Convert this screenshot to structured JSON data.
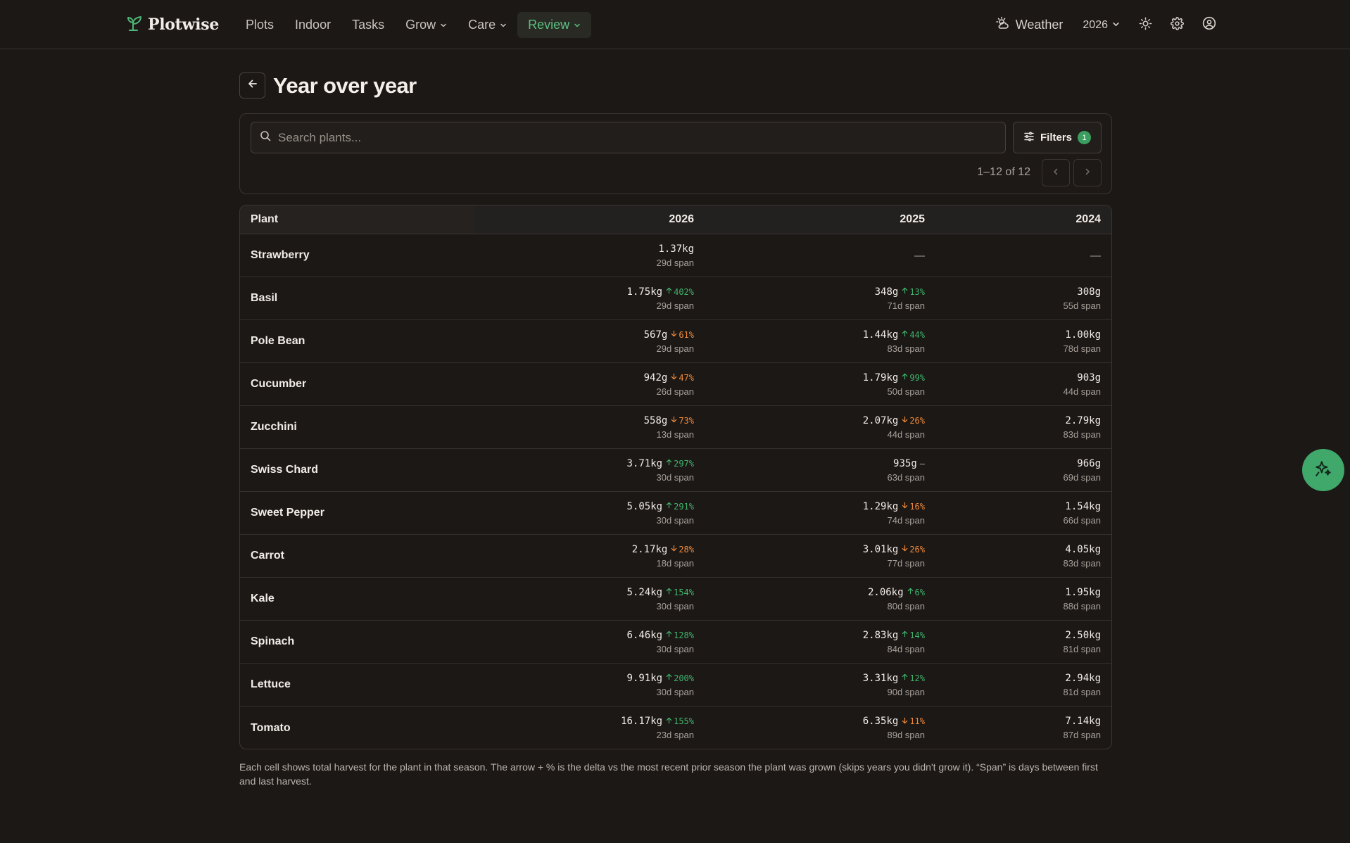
{
  "nav": {
    "brand": "Plotwise",
    "links": [
      {
        "label": "Plots",
        "dropdown": false,
        "active": false
      },
      {
        "label": "Indoor",
        "dropdown": false,
        "active": false
      },
      {
        "label": "Tasks",
        "dropdown": false,
        "active": false
      },
      {
        "label": "Grow",
        "dropdown": true,
        "active": false
      },
      {
        "label": "Care",
        "dropdown": true,
        "active": false
      },
      {
        "label": "Review",
        "dropdown": true,
        "active": true
      }
    ],
    "weather_label": "Weather",
    "year": "2026",
    "icons": [
      "sun-icon",
      "gear-icon",
      "user-circle-icon"
    ]
  },
  "page": {
    "title": "Year over year"
  },
  "toolbar": {
    "search_placeholder": "Search plants...",
    "filters_label": "Filters",
    "filters_count": "1",
    "pager_text": "1–12 of 12"
  },
  "table": {
    "headers": [
      "Plant",
      "2026",
      "2025",
      "2024"
    ],
    "rows": [
      {
        "plant": "Strawberry",
        "cells": [
          {
            "value": "1.37kg",
            "delta": "",
            "dir": "",
            "span": "29d span"
          },
          {
            "value": "—",
            "delta": "",
            "dir": "",
            "span": ""
          },
          {
            "value": "—",
            "delta": "",
            "dir": "",
            "span": ""
          }
        ]
      },
      {
        "plant": "Basil",
        "cells": [
          {
            "value": "1.75kg",
            "delta": "402%",
            "dir": "up",
            "span": "29d span"
          },
          {
            "value": "348g",
            "delta": "13%",
            "dir": "up",
            "span": "71d span"
          },
          {
            "value": "308g",
            "delta": "",
            "dir": "",
            "span": "55d span"
          }
        ]
      },
      {
        "plant": "Pole Bean",
        "cells": [
          {
            "value": "567g",
            "delta": "61%",
            "dir": "down",
            "span": "29d span"
          },
          {
            "value": "1.44kg",
            "delta": "44%",
            "dir": "up",
            "span": "83d span"
          },
          {
            "value": "1.00kg",
            "delta": "",
            "dir": "",
            "span": "78d span"
          }
        ]
      },
      {
        "plant": "Cucumber",
        "cells": [
          {
            "value": "942g",
            "delta": "47%",
            "dir": "down",
            "span": "26d span"
          },
          {
            "value": "1.79kg",
            "delta": "99%",
            "dir": "up",
            "span": "50d span"
          },
          {
            "value": "903g",
            "delta": "",
            "dir": "",
            "span": "44d span"
          }
        ]
      },
      {
        "plant": "Zucchini",
        "cells": [
          {
            "value": "558g",
            "delta": "73%",
            "dir": "down",
            "span": "13d span"
          },
          {
            "value": "2.07kg",
            "delta": "26%",
            "dir": "down",
            "span": "44d span"
          },
          {
            "value": "2.79kg",
            "delta": "",
            "dir": "",
            "span": "83d span"
          }
        ]
      },
      {
        "plant": "Swiss Chard",
        "cells": [
          {
            "value": "3.71kg",
            "delta": "297%",
            "dir": "up",
            "span": "30d span"
          },
          {
            "value": "935g",
            "delta": "—",
            "dir": "flat",
            "span": "63d span"
          },
          {
            "value": "966g",
            "delta": "",
            "dir": "",
            "span": "69d span"
          }
        ]
      },
      {
        "plant": "Sweet Pepper",
        "cells": [
          {
            "value": "5.05kg",
            "delta": "291%",
            "dir": "up",
            "span": "30d span"
          },
          {
            "value": "1.29kg",
            "delta": "16%",
            "dir": "down",
            "span": "74d span"
          },
          {
            "value": "1.54kg",
            "delta": "",
            "dir": "",
            "span": "66d span"
          }
        ]
      },
      {
        "plant": "Carrot",
        "cells": [
          {
            "value": "2.17kg",
            "delta": "28%",
            "dir": "down",
            "span": "18d span"
          },
          {
            "value": "3.01kg",
            "delta": "26%",
            "dir": "down",
            "span": "77d span"
          },
          {
            "value": "4.05kg",
            "delta": "",
            "dir": "",
            "span": "83d span"
          }
        ]
      },
      {
        "plant": "Kale",
        "cells": [
          {
            "value": "5.24kg",
            "delta": "154%",
            "dir": "up",
            "span": "30d span"
          },
          {
            "value": "2.06kg",
            "delta": "6%",
            "dir": "up",
            "span": "80d span"
          },
          {
            "value": "1.95kg",
            "delta": "",
            "dir": "",
            "span": "88d span"
          }
        ]
      },
      {
        "plant": "Spinach",
        "cells": [
          {
            "value": "6.46kg",
            "delta": "128%",
            "dir": "up",
            "span": "30d span"
          },
          {
            "value": "2.83kg",
            "delta": "14%",
            "dir": "up",
            "span": "84d span"
          },
          {
            "value": "2.50kg",
            "delta": "",
            "dir": "",
            "span": "81d span"
          }
        ]
      },
      {
        "plant": "Lettuce",
        "cells": [
          {
            "value": "9.91kg",
            "delta": "200%",
            "dir": "up",
            "span": "30d span"
          },
          {
            "value": "3.31kg",
            "delta": "12%",
            "dir": "up",
            "span": "90d span"
          },
          {
            "value": "2.94kg",
            "delta": "",
            "dir": "",
            "span": "81d span"
          }
        ]
      },
      {
        "plant": "Tomato",
        "cells": [
          {
            "value": "16.17kg",
            "delta": "155%",
            "dir": "up",
            "span": "23d span"
          },
          {
            "value": "6.35kg",
            "delta": "11%",
            "dir": "down",
            "span": "89d span"
          },
          {
            "value": "7.14kg",
            "delta": "",
            "dir": "",
            "span": "87d span"
          }
        ]
      }
    ]
  },
  "footnote": "Each cell shows total harvest for the plant in that season. The arrow + % is the delta vs the most recent prior season the plant was grown (skips years you didn't grow it). “Span” is days between first and last harvest.",
  "fab_icon": "sparkle-icon",
  "colors": {
    "accent": "#3fa86a",
    "up": "#3fb36b",
    "down": "#f08a3a",
    "background": "#1c1816"
  }
}
